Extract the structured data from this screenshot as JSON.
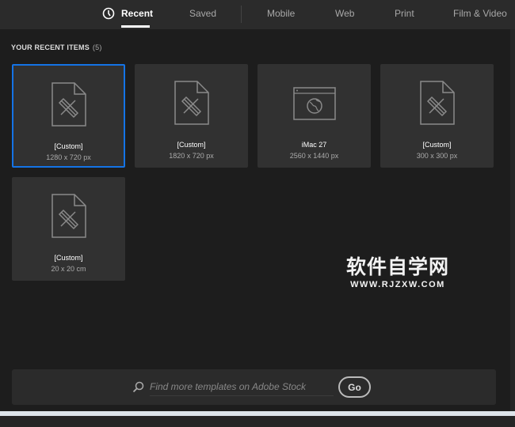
{
  "tabs": [
    {
      "label": "Recent",
      "icon": "clock-icon",
      "active": true
    },
    {
      "label": "Saved"
    },
    {
      "label": "Mobile"
    },
    {
      "label": "Web"
    },
    {
      "label": "Print"
    },
    {
      "label": "Film & Video"
    }
  ],
  "section": {
    "title": "YOUR RECENT ITEMS",
    "count": "(5)"
  },
  "items": [
    {
      "name": "[Custom]",
      "size": "1280 x 720 px",
      "icon": "document-icon",
      "selected": true
    },
    {
      "name": "[Custom]",
      "size": "1820 x 720 px",
      "icon": "document-icon"
    },
    {
      "name": "iMac 27",
      "size": "2560 x 1440 px",
      "icon": "web-icon"
    },
    {
      "name": "[Custom]",
      "size": "300 x 300 px",
      "icon": "document-icon"
    },
    {
      "name": "[Custom]",
      "size": "20 x 20 cm",
      "icon": "document-icon"
    }
  ],
  "search": {
    "placeholder": "Find more templates on Adobe Stock",
    "go_label": "Go"
  },
  "watermark": {
    "cn": "软件自学网",
    "en": "WWW.RJZXW.COM"
  },
  "colors": {
    "accent": "#1473e6"
  }
}
